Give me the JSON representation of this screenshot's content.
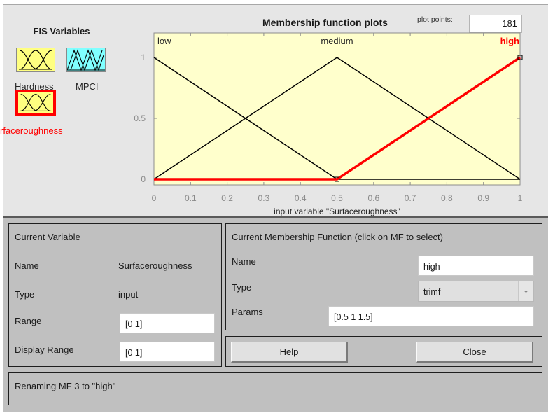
{
  "fis_variables": {
    "title": "FIS Variables",
    "items": [
      {
        "name": "Hardness",
        "kind": "input",
        "color": "#ffff80",
        "selected": false
      },
      {
        "name": "MPCI",
        "kind": "output",
        "color": "#80ffff",
        "selected": false
      },
      {
        "name": "Surfaceroughness",
        "kind": "input",
        "color": "#ffff80",
        "selected": true
      }
    ],
    "visible_label_selected": "rfaceroughness"
  },
  "plot": {
    "title": "Membership function plots",
    "plot_points_label": "plot points:",
    "plot_points_value": "181"
  },
  "chart_data": {
    "type": "line",
    "title": "Membership function plots",
    "xlabel": "input variable \"Surfaceroughness\"",
    "ylabel": "",
    "xlim": [
      0,
      1
    ],
    "ylim": [
      0,
      1
    ],
    "xticks": [
      "0",
      "0.1",
      "0.2",
      "0.3",
      "0.4",
      "0.5",
      "0.6",
      "0.7",
      "0.8",
      "0.9",
      "1"
    ],
    "yticks": [
      "0",
      "0.5",
      "1"
    ],
    "grid": false,
    "background": "#ffffcc",
    "series": [
      {
        "name": "low",
        "mf_type": "trimf",
        "params": [
          -0.5,
          0,
          0.5
        ],
        "x": [
          0,
          0.5,
          1
        ],
        "y": [
          1,
          0,
          0
        ],
        "color": "#000000",
        "selected": false
      },
      {
        "name": "medium",
        "mf_type": "trimf",
        "params": [
          0,
          0.5,
          1
        ],
        "x": [
          0,
          0.5,
          1
        ],
        "y": [
          0,
          1,
          0
        ],
        "color": "#000000",
        "selected": false
      },
      {
        "name": "high",
        "mf_type": "trimf",
        "params": [
          0.5,
          1,
          1.5
        ],
        "x": [
          0,
          0.5,
          1
        ],
        "y": [
          0,
          0,
          1
        ],
        "color": "#ff0000",
        "selected": true
      }
    ]
  },
  "current_variable": {
    "title": "Current Variable",
    "name_label": "Name",
    "name_value": "Surfaceroughness",
    "type_label": "Type",
    "type_value": "input",
    "range_label": "Range",
    "range_value": "[0 1]",
    "display_range_label": "Display Range",
    "display_range_value": "[0 1]"
  },
  "current_mf": {
    "title": "Current Membership Function (click on MF to select)",
    "name_label": "Name",
    "name_value": "high",
    "type_label": "Type",
    "type_value": "trimf",
    "params_label": "Params",
    "params_value": "[0.5 1 1.5]"
  },
  "buttons": {
    "help": "Help",
    "close": "Close"
  },
  "status": {
    "message": "Renaming MF 3 to \"high\""
  }
}
